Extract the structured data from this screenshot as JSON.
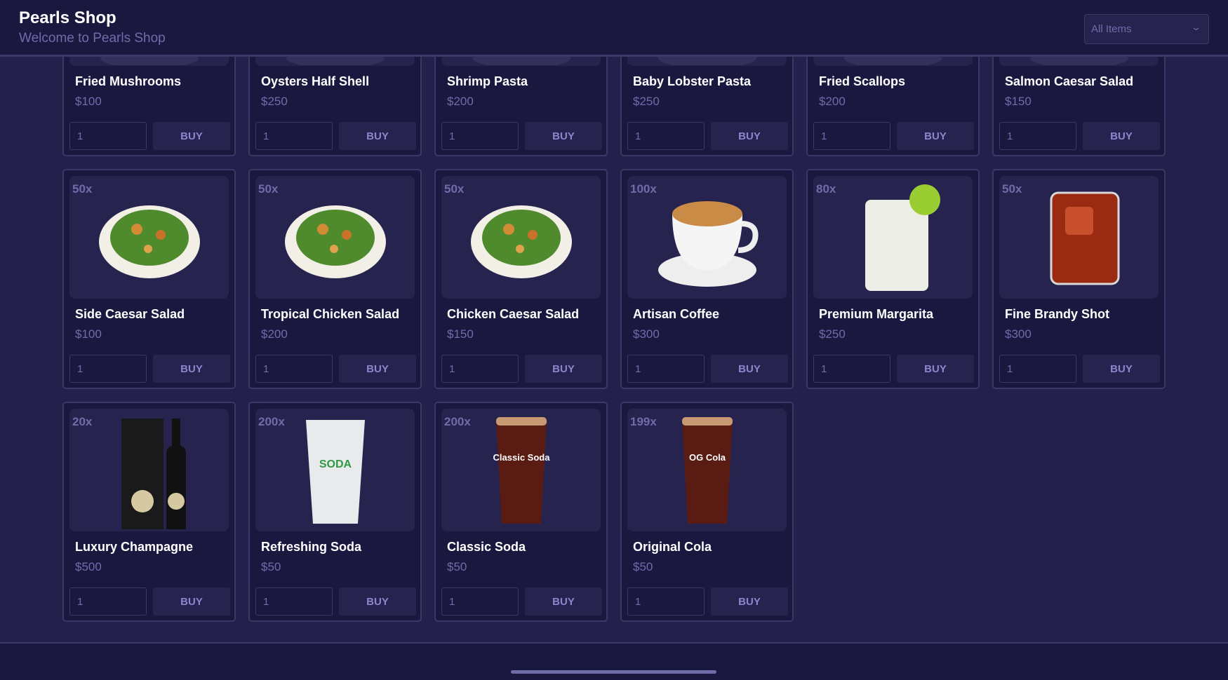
{
  "header": {
    "title": "Pearls Shop",
    "subtitle": "Welcome to Pearls Shop",
    "filter": {
      "selected": "All Items"
    }
  },
  "buy_label": "BUY",
  "products": [
    {
      "name": "Fried Mushrooms",
      "price": "$100",
      "stock": "",
      "qty": "1",
      "kind": "plate"
    },
    {
      "name": "Oysters Half Shell",
      "price": "$250",
      "stock": "",
      "qty": "1",
      "kind": "plate"
    },
    {
      "name": "Shrimp Pasta",
      "price": "$200",
      "stock": "",
      "qty": "1",
      "kind": "plate"
    },
    {
      "name": "Baby Lobster Pasta",
      "price": "$250",
      "stock": "",
      "qty": "1",
      "kind": "plate"
    },
    {
      "name": "Fried Scallops",
      "price": "$200",
      "stock": "",
      "qty": "1",
      "kind": "plate"
    },
    {
      "name": "Salmon Caesar Salad",
      "price": "$150",
      "stock": "",
      "qty": "1",
      "kind": "plate"
    },
    {
      "name": "Side Caesar Salad",
      "price": "$100",
      "stock": "50x",
      "qty": "1",
      "kind": "salad"
    },
    {
      "name": "Tropical Chicken Salad",
      "price": "$200",
      "stock": "50x",
      "qty": "1",
      "kind": "salad"
    },
    {
      "name": "Chicken Caesar Salad",
      "price": "$150",
      "stock": "50x",
      "qty": "1",
      "kind": "salad"
    },
    {
      "name": "Artisan Coffee",
      "price": "$300",
      "stock": "100x",
      "qty": "1",
      "kind": "coffee"
    },
    {
      "name": "Premium Margarita",
      "price": "$250",
      "stock": "80x",
      "qty": "1",
      "kind": "margarita"
    },
    {
      "name": "Fine Brandy Shot",
      "price": "$300",
      "stock": "50x",
      "qty": "1",
      "kind": "brandy"
    },
    {
      "name": "Luxury Champagne",
      "price": "$500",
      "stock": "20x",
      "qty": "1",
      "kind": "champagne"
    },
    {
      "name": "Refreshing Soda",
      "price": "$50",
      "stock": "200x",
      "qty": "1",
      "kind": "soda",
      "label": "SODA"
    },
    {
      "name": "Classic Soda",
      "price": "$50",
      "stock": "200x",
      "qty": "1",
      "kind": "cola",
      "label": "Classic Soda"
    },
    {
      "name": "Original Cola",
      "price": "$50",
      "stock": "199x",
      "qty": "1",
      "kind": "cola",
      "label": "OG Cola"
    }
  ]
}
